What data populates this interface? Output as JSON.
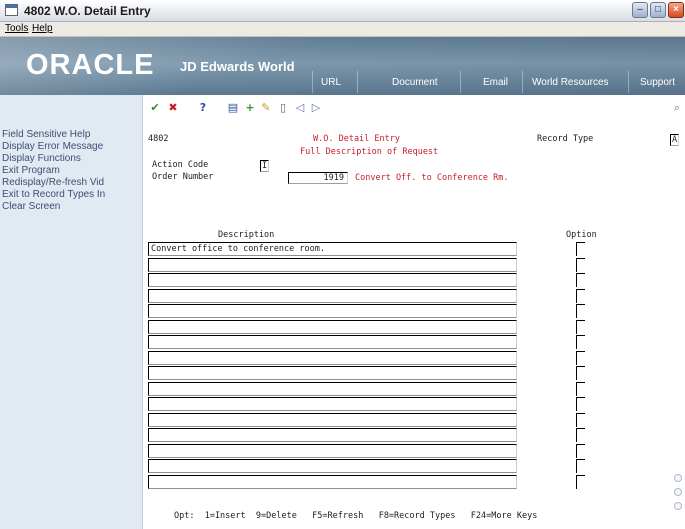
{
  "window": {
    "title": "4802    W.O. Detail Entry"
  },
  "menu": {
    "tools": "Tools",
    "help": "Help"
  },
  "banner": {
    "brand": "ORACLE",
    "brand_sub": "JD Edwards World",
    "tabs": [
      "URL",
      "Document",
      "Email",
      "World Resources",
      "Support"
    ]
  },
  "toolbar": {
    "icons": [
      "check-icon",
      "cancel-icon",
      "help-icon",
      "display-icon",
      "add-icon",
      "edit-icon",
      "delete-icon",
      "previous-icon",
      "next-icon"
    ]
  },
  "sidebar": {
    "items": [
      "Field Sensitive Help",
      "Display Error Message",
      "Display Functions",
      "Exit Program",
      "Redisplay/Re-fresh Vid",
      "Exit to Record Types In",
      "Clear Screen"
    ]
  },
  "form": {
    "program_id": "4802",
    "form_title": "W.O. Detail Entry",
    "form_subtitle": "Full Description of Request",
    "record_type_label": "Record Type",
    "record_type_value": "A",
    "action_code_label": "Action Code",
    "action_code_value": "I",
    "order_number_label": "Order Number",
    "order_number_value": "1919",
    "order_description": "Convert Off. to Conference Rm.",
    "description_header": "Description",
    "option_header": "Option",
    "description_rows": [
      "Convert office to conference room.",
      "",
      "",
      "",
      "",
      "",
      "",
      "",
      "",
      "",
      "",
      "",
      "",
      "",
      "",
      ""
    ],
    "footer_keys": "Opt:  1=Insert  9=Delete   F5=Refresh   F8=Record Types   F24=More Keys"
  },
  "colors": {
    "label_red": "#c8202a",
    "banner": "#6f8ba1",
    "sidebar_bg": "#e1e9f3",
    "sidebar_text": "#3d4f73"
  }
}
